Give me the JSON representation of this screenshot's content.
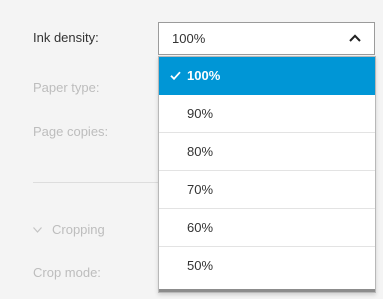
{
  "settings": {
    "ink_density_label": "Ink density:",
    "paper_type_label": "Paper type:",
    "page_copies_label": "Page copies:",
    "cropping_label": "Cropping",
    "crop_mode_label": "Crop mode:"
  },
  "ink_density_select": {
    "value": "100%",
    "options": [
      "100%",
      "90%",
      "80%",
      "70%",
      "60%",
      "50%"
    ],
    "selected_index": 0
  },
  "colors": {
    "accent": "#0096d6",
    "label_text": "#333333",
    "disabled_text": "#bdbdbd"
  },
  "icons": {
    "caret": "chevron-up-icon",
    "check": "check-icon",
    "section_toggle": "chevron-down-icon"
  }
}
